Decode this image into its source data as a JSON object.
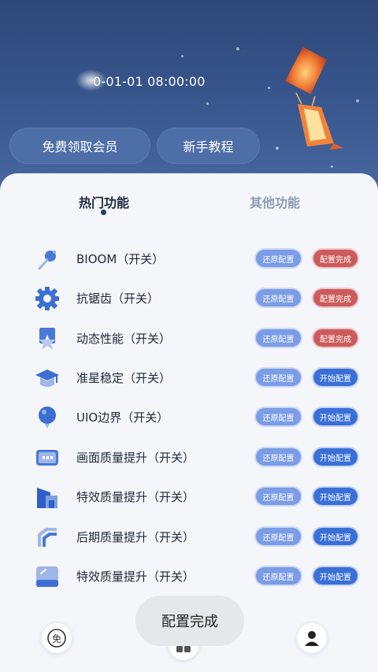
{
  "header": {
    "datetime": "0-01-01 08:00:00",
    "buttons": {
      "free_vip": "免费领取会员",
      "tutorial": "新手教程"
    }
  },
  "tabs": {
    "hot": "热门功能",
    "other": "其他功能"
  },
  "buttons": {
    "restore": "还原配置",
    "done": "配置完成",
    "start": "开始配置"
  },
  "features": [
    {
      "label": "BIOOM（开关）",
      "icon": "pin-icon",
      "status": "done"
    },
    {
      "label": "抗锯齿（开关）",
      "icon": "gear-icon",
      "status": "done"
    },
    {
      "label": "动态性能（开关）",
      "icon": "star-badge-icon",
      "status": "done"
    },
    {
      "label": "准星稳定（开关）",
      "icon": "graduation-cap-icon",
      "status": "start"
    },
    {
      "label": "UIO边界（开关）",
      "icon": "balloon-icon",
      "status": "start"
    },
    {
      "label": "画面质量提升（开关）",
      "icon": "screen-icon",
      "status": "start"
    },
    {
      "label": "特效质量提升（开关）",
      "icon": "building-icon",
      "status": "start"
    },
    {
      "label": "后期质量提升（开关）",
      "icon": "frame-icon",
      "status": "start"
    },
    {
      "label": "特效质量提升（开关）",
      "icon": "tablet-icon",
      "status": "start"
    }
  ],
  "toast": "配置完成",
  "bottom_nav": {
    "left_icon": "free-icon",
    "left_glyph": "免",
    "center_icon": "grid-icon",
    "right_icon": "user-icon"
  },
  "colors": {
    "header": "#3b5a92",
    "restore": "#7b9ce6",
    "done": "#cc5b5b",
    "start": "#3b6fd8"
  }
}
